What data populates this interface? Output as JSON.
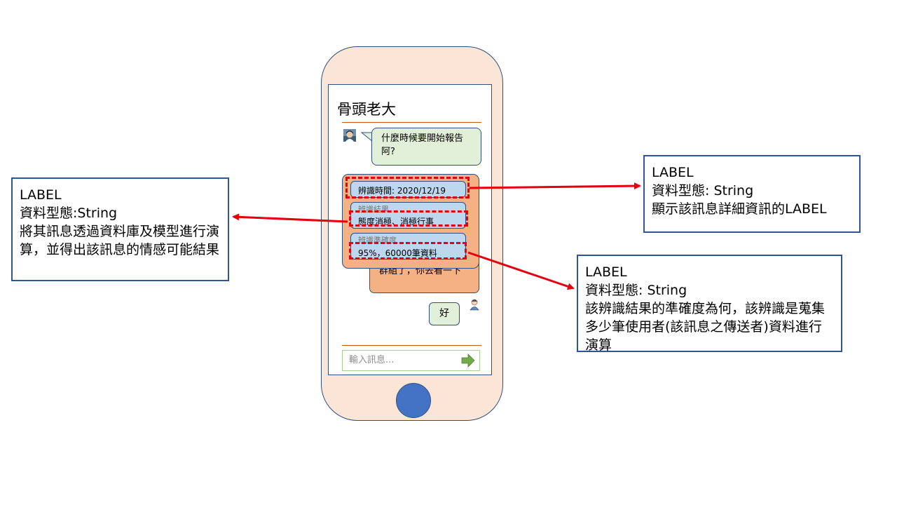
{
  "phone": {
    "chat_title": "骨頭老大",
    "message_in": "什麼時候要開始報告阿?",
    "message_in2": "群組了，你去看一下",
    "reply": "好",
    "input_placeholder": "輸入訊息...",
    "info_panel": {
      "time_label": "辨識時間:",
      "time_value": "2020/12/19",
      "result_label": "辨識結果",
      "result_value": "態度消極、消極行事",
      "accuracy_label": "辨識準確度",
      "accuracy_value": "95%，60000筆資料"
    }
  },
  "callouts": {
    "left": {
      "title": "LABEL",
      "type": "資料型態:String",
      "desc": "將其訊息透過資料庫及模型進行演算，並得出該訊息的情感可能結果"
    },
    "top_right": {
      "title": "LABEL",
      "type": "資料型態: String",
      "desc": "顯示該訊息詳細資訊的LABEL"
    },
    "bottom_right": {
      "title": "LABEL",
      "type": "資料型態: String",
      "desc": "該辨識結果的準確度為何，該辨識是蒐集多少筆使用者(該訊息之傳送者)資料進行演算"
    }
  },
  "colors": {
    "phone_body": "#fbe5d6",
    "phone_border": "#2f4f7f",
    "home_button": "#4472c4",
    "bubble_green": "#e2f0d9",
    "bubble_orange": "#f4b183",
    "info_box": "#bdd7ee",
    "dashed_highlight": "#e3000f",
    "arrow": "#e3000f",
    "callout_border": "#2f5597",
    "send_icon": "#70ad47"
  },
  "icons": {
    "sender_avatar": "person-photo-icon",
    "user_avatar": "person-icon",
    "send": "send-arrow-icon"
  }
}
